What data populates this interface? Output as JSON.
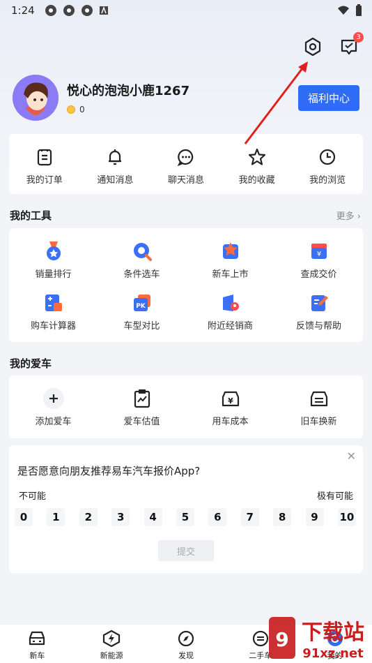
{
  "status": {
    "time": "1:24"
  },
  "header": {
    "settings_icon": "settings-icon",
    "messages_icon": "message-icon",
    "messages_badge": "3"
  },
  "profile": {
    "username": "悦心的泡泡小鹿1267",
    "coins": "0",
    "welfare_label": "福利中心"
  },
  "quick_links": [
    {
      "label": "我的订单",
      "icon": "order-icon"
    },
    {
      "label": "通知消息",
      "icon": "bell-icon"
    },
    {
      "label": "聊天消息",
      "icon": "chat-icon"
    },
    {
      "label": "我的收藏",
      "icon": "star-icon"
    },
    {
      "label": "我的浏览",
      "icon": "clock-icon"
    }
  ],
  "tools": {
    "title": "我的工具",
    "more_label": "更多 ›",
    "items": [
      {
        "label": "销量排行",
        "icon": "medal-icon"
      },
      {
        "label": "条件选车",
        "icon": "search-car-icon"
      },
      {
        "label": "新车上市",
        "icon": "new-car-icon"
      },
      {
        "label": "查成交价",
        "icon": "price-icon"
      },
      {
        "label": "购车计算器",
        "icon": "calculator-icon"
      },
      {
        "label": "车型对比",
        "icon": "compare-icon"
      },
      {
        "label": "附近经销商",
        "icon": "dealer-icon"
      },
      {
        "label": "反馈与帮助",
        "icon": "feedback-icon"
      }
    ]
  },
  "my_car": {
    "title": "我的爱车",
    "items": [
      {
        "label": "添加爱车",
        "icon": "plus-icon"
      },
      {
        "label": "爱车估值",
        "icon": "valuation-icon"
      },
      {
        "label": "用车成本",
        "icon": "cost-icon"
      },
      {
        "label": "旧车换新",
        "icon": "trade-in-icon"
      }
    ]
  },
  "survey": {
    "question": "是否愿意向朋友推荐易车汽车报价App?",
    "low_label": "不可能",
    "high_label": "极有可能",
    "scale": [
      "0",
      "1",
      "2",
      "3",
      "4",
      "5",
      "6",
      "7",
      "8",
      "9",
      "10"
    ],
    "submit_label": "提交"
  },
  "tabs": [
    {
      "label": "新车",
      "icon": "car-icon"
    },
    {
      "label": "新能源",
      "icon": "ev-icon"
    },
    {
      "label": "发现",
      "icon": "compass-icon"
    },
    {
      "label": "二手车",
      "icon": "used-car-icon"
    },
    {
      "label": "我的",
      "icon": "profile-icon"
    }
  ],
  "watermark": {
    "text": "下载站",
    "sub": "91xz.net"
  },
  "colors": {
    "accent": "#2f6cf6",
    "badge": "#ff4d4f",
    "arrow": "#e0201f"
  }
}
